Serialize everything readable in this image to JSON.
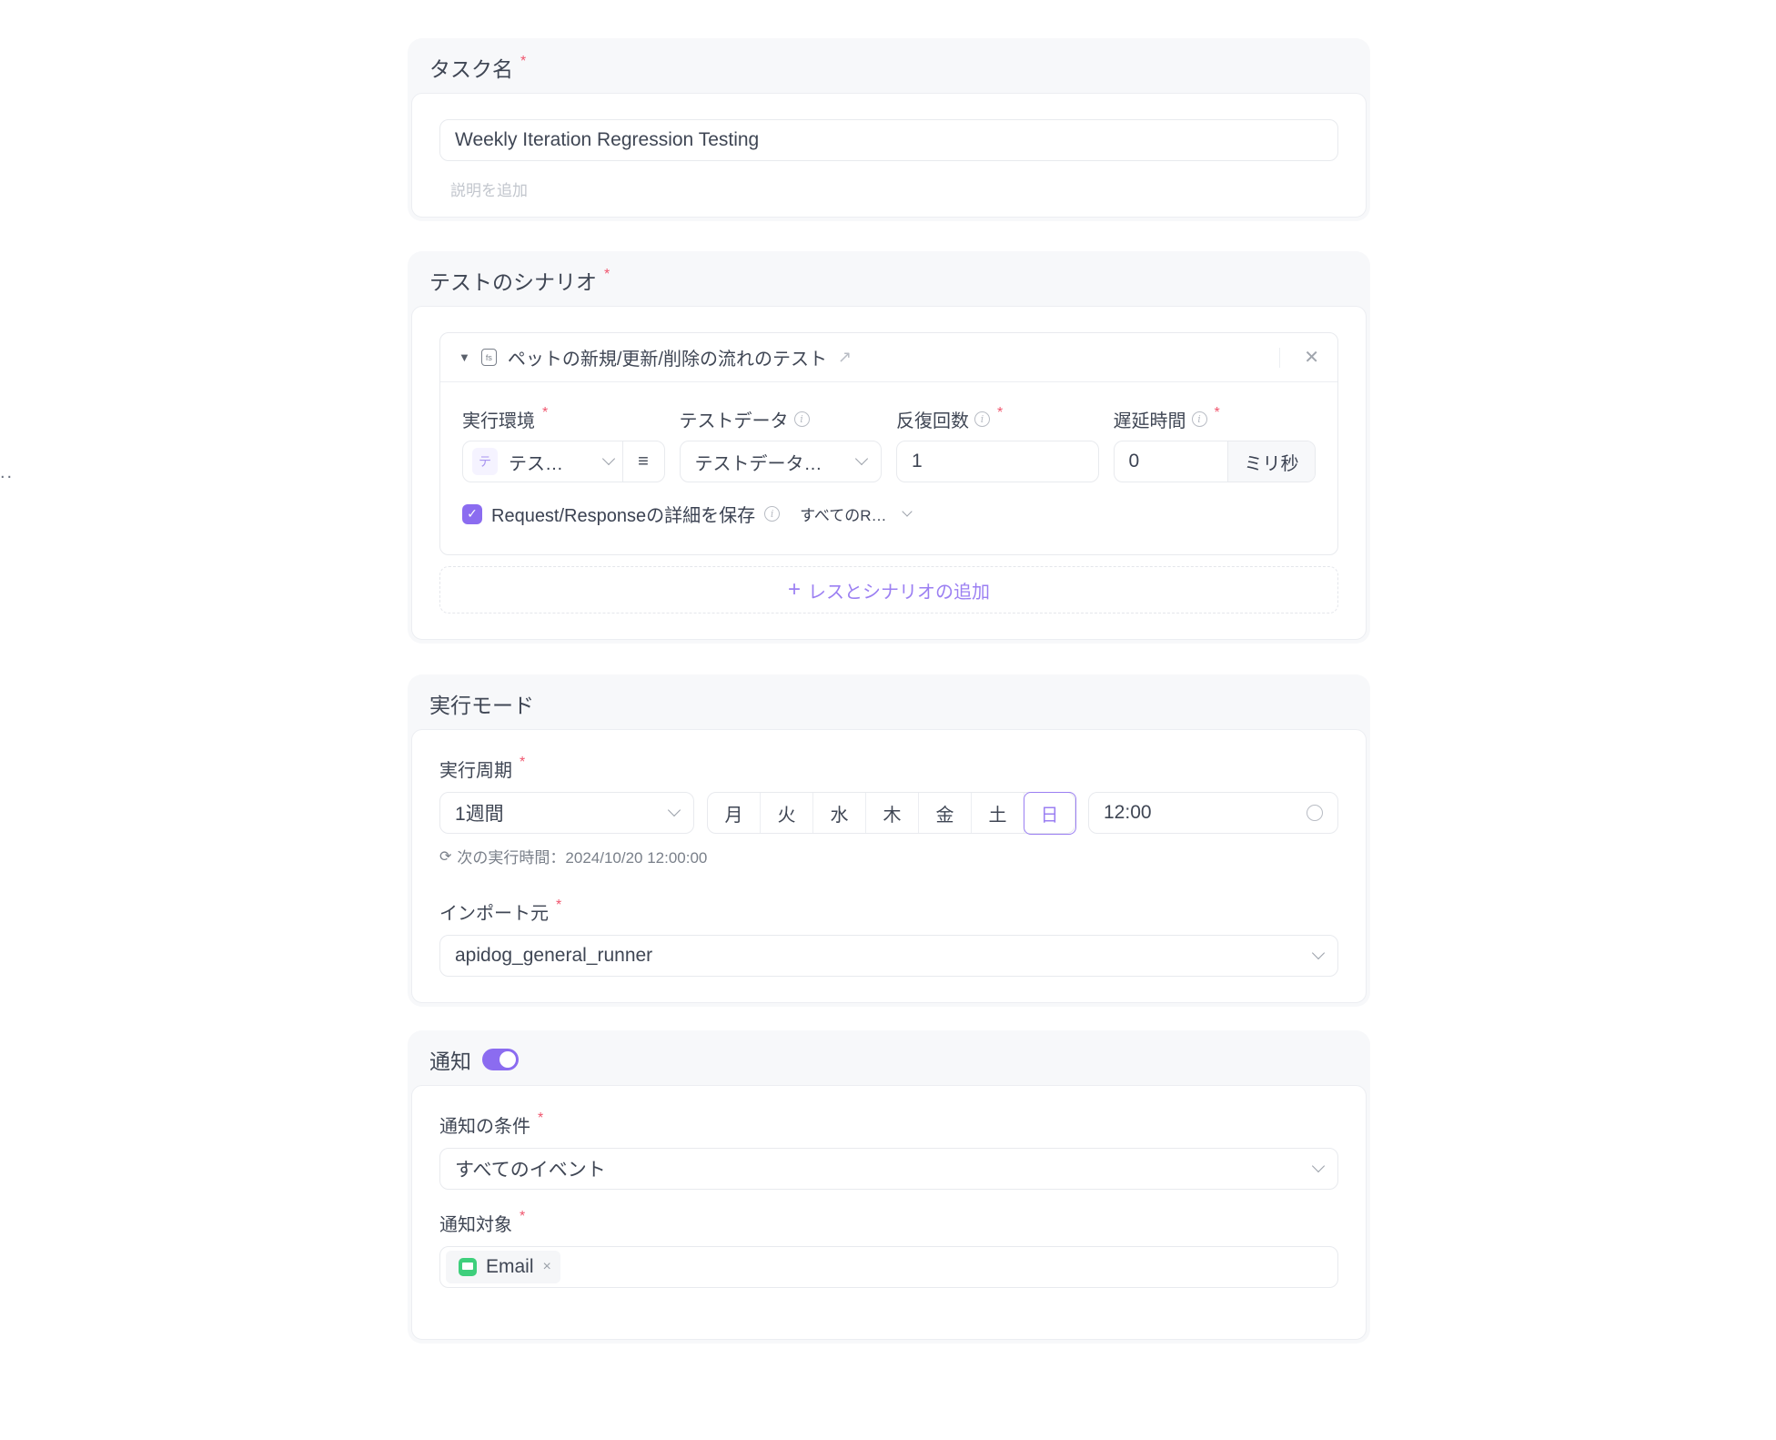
{
  "edge_text": "..",
  "task_name": {
    "title": "タスク名",
    "required": "*",
    "value": "Weekly Iteration Regression Testing",
    "description_placeholder": "説明を追加"
  },
  "scenarios": {
    "title": "テストのシナリオ",
    "required": "*",
    "items": [
      {
        "name": "ペットの新規/更新/削除の流れのテスト",
        "env_label": "実行環境",
        "env_badge": "テ",
        "env_value": "テス…",
        "data_label": "テストデータ",
        "data_value": "テストデータ…",
        "iterations_label": "反復回数",
        "iterations_value": "1",
        "delay_label": "遅延時間",
        "delay_value": "0",
        "delay_unit": "ミリ秒",
        "save_details_label": "Request/Responseの詳細を保存",
        "save_details_checked": true,
        "save_scope_value": "すべてのR…"
      }
    ],
    "add_label": "レスとシナリオの追加"
  },
  "run_mode": {
    "title": "実行モード",
    "period_label": "実行周期",
    "period_value": "1週間",
    "weekdays": [
      "月",
      "火",
      "水",
      "木",
      "金",
      "土",
      "日"
    ],
    "selected_weekday": "日",
    "time_value": "12:00",
    "next_run": "次の実行時間：2024/10/20 12:00:00",
    "import_label": "インポート元",
    "import_value": "apidog_general_runner"
  },
  "notification": {
    "title": "通知",
    "enabled": true,
    "condition_label": "通知の条件",
    "condition_value": "すべてのイベント",
    "target_label": "通知対象",
    "targets": [
      "Email"
    ]
  },
  "colors": {
    "accent": "#8b6cf0",
    "required": "#f0566e",
    "email": "#3ecf7c"
  }
}
